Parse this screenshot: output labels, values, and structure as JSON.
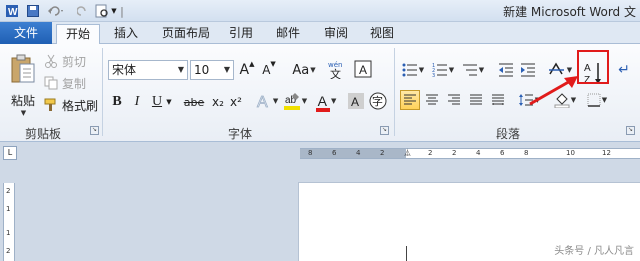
{
  "window": {
    "title": "新建 Microsoft Word 文"
  },
  "tabs": [
    {
      "label": "文件"
    },
    {
      "label": "开始"
    },
    {
      "label": "插入"
    },
    {
      "label": "页面布局"
    },
    {
      "label": "引用"
    },
    {
      "label": "邮件"
    },
    {
      "label": "审阅"
    },
    {
      "label": "视图"
    }
  ],
  "clipboard": {
    "paste": "粘贴",
    "cut": "剪切",
    "copy": "复制",
    "format_painter": "格式刷",
    "group_label": "剪贴板"
  },
  "font": {
    "font_name": "宋体",
    "font_size": "10",
    "group_label": "字体",
    "bold": "B",
    "italic": "I",
    "underline": "U",
    "strikethrough": "abe",
    "subscript": "x₂",
    "superscript": "x²",
    "grow": "A",
    "shrink": "A",
    "change_case": "Aa",
    "clear_format": "A",
    "font_color": "A"
  },
  "paragraph": {
    "group_label": "段落"
  },
  "ruler": {
    "ticks": [
      "8",
      "6",
      "4",
      "2",
      "2",
      "2",
      "4",
      "6",
      "8",
      "10",
      "12"
    ],
    "vticks": [
      "2",
      "1",
      "1",
      "2"
    ]
  },
  "watermark": "头条号 / 凡人凡言",
  "colors": {
    "accent": "#2b6cc4",
    "highlight_box": "#e11b1b",
    "font_color_bar": "#e11b1b",
    "highlight_bar": "#f0e000"
  }
}
